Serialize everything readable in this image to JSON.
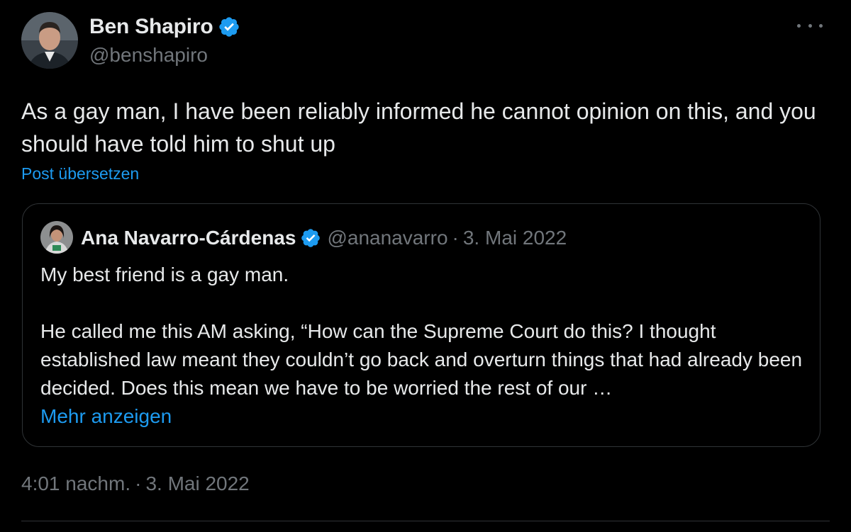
{
  "author": {
    "display_name": "Ben Shapiro",
    "handle": "@benshapiro",
    "verified": true
  },
  "post": {
    "text": "As a gay man, I have been reliably informed he cannot opinion on this, and you should have told him to shut up",
    "translate_label": "Post übersetzen"
  },
  "quoted_post": {
    "display_name": "Ana Navarro-Cárdenas",
    "handle": "@ananavarro",
    "separator": "·",
    "date": "3. Mai 2022",
    "paragraph_1": "My best friend is a gay man.",
    "paragraph_2": "He called me this AM asking, “How can the Supreme Court do this? I thought established law meant they couldn’t go back and overturn things that had already been decided. Does this mean we have to be worried the rest of our …",
    "show_more_label": "Mehr anzeigen"
  },
  "footer": {
    "time": "4:01 nachm.",
    "separator": "·",
    "date": "3. Mai 2022"
  },
  "icons": {
    "verified": "verified-badge-icon",
    "more": "more-options-icon"
  },
  "colors": {
    "background": "#000000",
    "text_primary": "#e7e9ea",
    "text_secondary": "#71767b",
    "link": "#1d9bf0",
    "border": "#2f3336",
    "verified_badge": "#1d9bf0"
  }
}
